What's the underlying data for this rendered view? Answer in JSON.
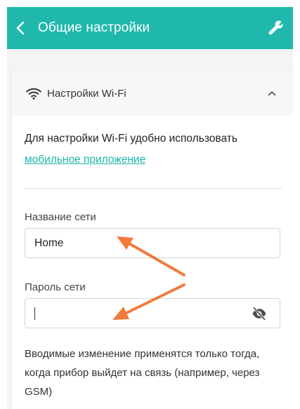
{
  "app_bar": {
    "title": "Общие настройки",
    "back_icon": "chevron-left-icon",
    "tools_icon": "wrench-icon",
    "color": "#20b8ad"
  },
  "wifi_section": {
    "header": "Настройки Wi-Fi",
    "header_icon": "wifi-icon",
    "collapse_icon": "chevron-up-icon",
    "info_text": "Для настройки Wi-Fi удобно использовать",
    "info_link": "мобильное приложение",
    "link_color": "#1eb5a9"
  },
  "fields": {
    "network_label": "Название сети",
    "network_value": "Home",
    "password_label": "Пароль сети",
    "password_value": "",
    "visibility_icon": "eye-off-icon"
  },
  "note": "Вводимые изменение применятся только тогда, когда прибор выйдет на связь (например, через GSM)",
  "annotation": {
    "arrow_color": "#f07a3c"
  }
}
